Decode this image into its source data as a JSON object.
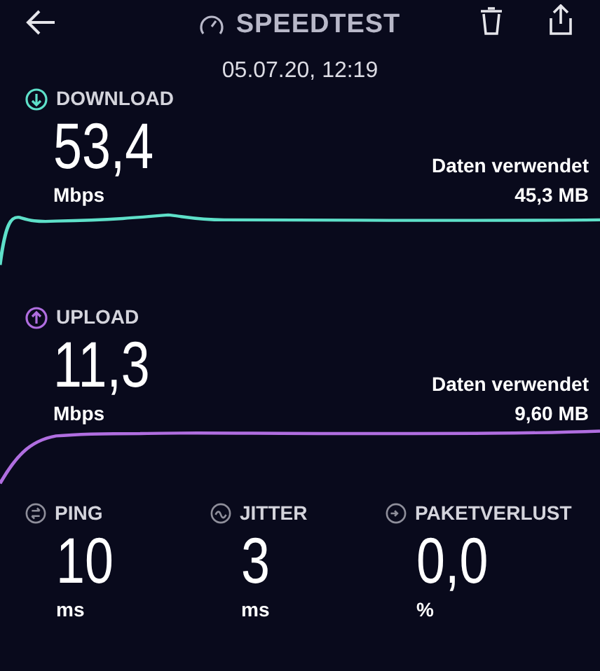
{
  "header": {
    "title": "SPEEDTEST",
    "date": "05.07.20, 12:19"
  },
  "tests": [
    {
      "kind": "download",
      "label": "DOWNLOAD",
      "value": "53,4",
      "unit": "Mbps",
      "data_label": "Daten verwendet",
      "data_value": "45,3 MB",
      "color": "#5ee0c9"
    },
    {
      "kind": "upload",
      "label": "UPLOAD",
      "value": "11,3",
      "unit": "Mbps",
      "data_label": "Daten verwendet",
      "data_value": "9,60 MB",
      "color": "#b06ee0"
    }
  ],
  "stats": [
    {
      "kind": "ping",
      "label": "PING",
      "value": "10",
      "unit": "ms"
    },
    {
      "kind": "jitter",
      "label": "JITTER",
      "value": "3",
      "unit": "ms"
    },
    {
      "kind": "loss",
      "label": "PAKETVERLUST",
      "value": "0,0",
      "unit": "%"
    }
  ]
}
